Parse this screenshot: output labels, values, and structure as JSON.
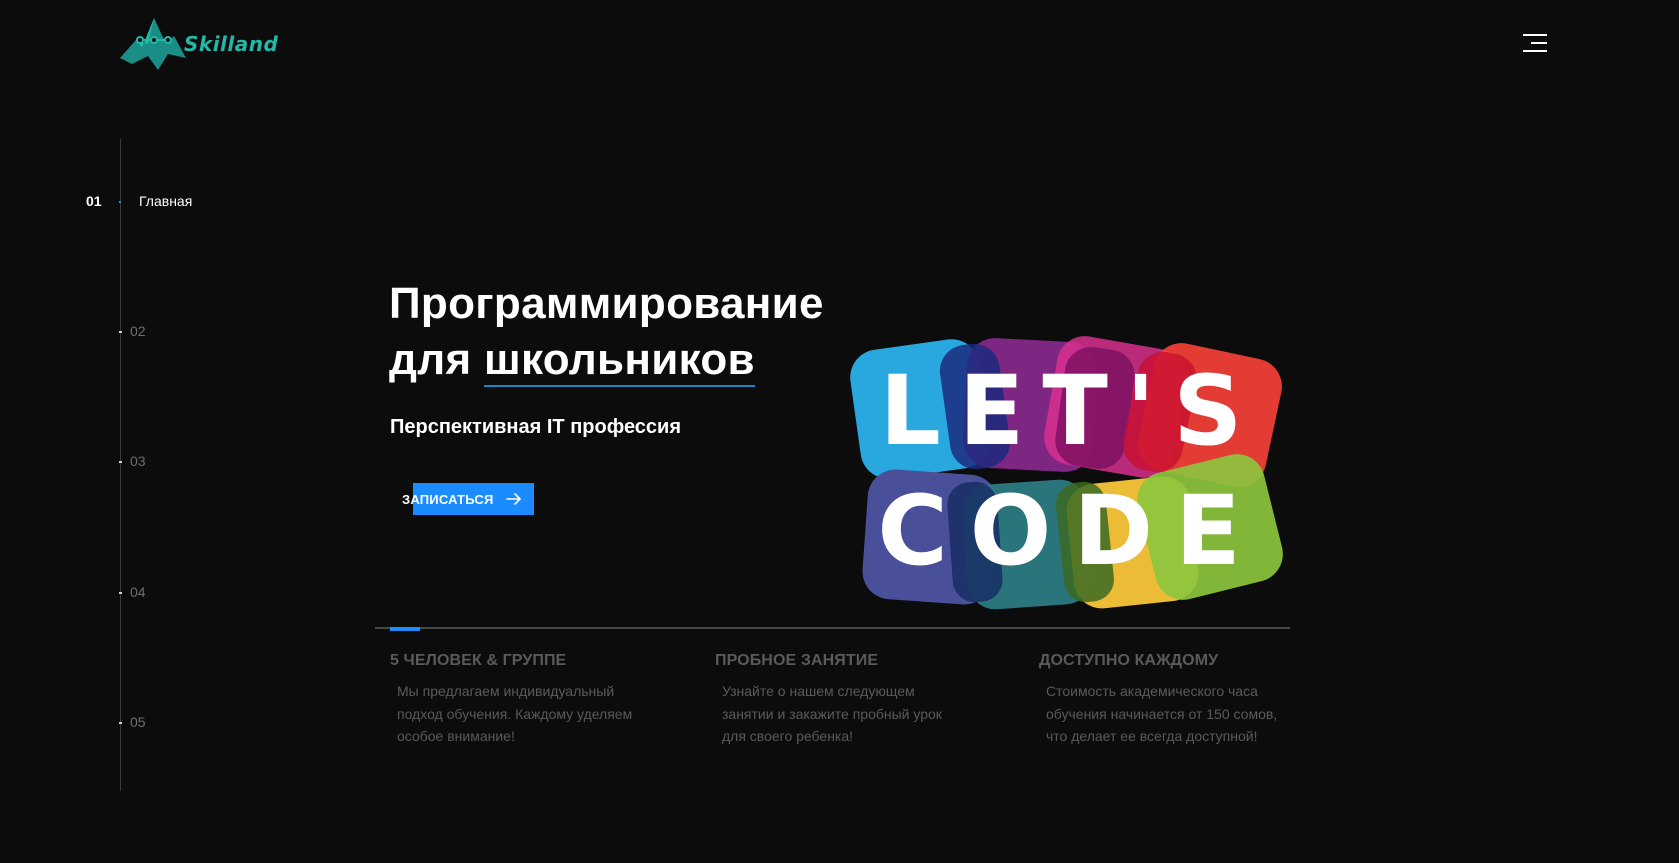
{
  "header": {
    "logo_text": "Skilland",
    "menu_icon": "hamburger-menu-icon"
  },
  "side_nav": {
    "items": [
      {
        "num": "01",
        "label": "Главная",
        "active": true
      },
      {
        "num": "02",
        "label": "",
        "active": false
      },
      {
        "num": "03",
        "label": "",
        "active": false
      },
      {
        "num": "04",
        "label": "",
        "active": false
      },
      {
        "num": "05",
        "label": "",
        "active": false
      }
    ]
  },
  "hero": {
    "title_line1": "Программирование",
    "title_line2_prefix": "для ",
    "title_line2_highlight": "школьников",
    "subtitle": "Перспективная IT профессия",
    "cta_label": "ЗАПИСАТЬСЯ",
    "cta_icon": "arrow-right-icon",
    "graphic_line1": "LET'S",
    "graphic_line2": "CODE"
  },
  "slider": {
    "progress": 0.033
  },
  "features": [
    {
      "title": "5 ЧЕЛОВЕК & ГРУППЕ",
      "text": "Мы предлагаем индивидуальный подход обучения. Каждому уделяем особое внимание!"
    },
    {
      "title": "ПРОБНОЕ ЗАНЯТИЕ",
      "text": "Узнайте о нашем следующем занятии и закажите пробный урок для своего ребенка!"
    },
    {
      "title": "ДОСТУПНО КАЖДОМУ",
      "text": "Стоимость академического часа обучения начинается от 150 сомов, что делает ее всегда доступной!"
    }
  ],
  "colors": {
    "background": "#0c0c0c",
    "accent": "#1a8cff",
    "logo": "#23b8a7",
    "muted_text": "#5a5a5a"
  }
}
